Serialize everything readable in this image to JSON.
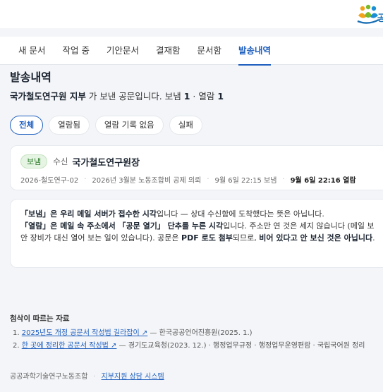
{
  "logo": {
    "text": "공"
  },
  "nav": {
    "tabs": [
      {
        "label": "새 문서"
      },
      {
        "label": "작업 중"
      },
      {
        "label": "기안문서"
      },
      {
        "label": "결재함"
      },
      {
        "label": "문서함"
      },
      {
        "label": "발송내역"
      }
    ],
    "active_index": 5
  },
  "page": {
    "title": "발송내역",
    "summary": {
      "sender": "국가철도연구원 지부",
      "text": " 가 보낸 공문입니다. 보냄 ",
      "sent_count": "1",
      "sep": " · 열람 ",
      "opened_count": "1"
    }
  },
  "filters": [
    "전체",
    "열람됨",
    "열람 기록 없음",
    "실패"
  ],
  "record": {
    "status": "보냄",
    "to_label": "수신",
    "recipient": "국가철도연구원장",
    "doc_no": "2026-철도연구-02",
    "subject": "2026년 3월분 노동조합비 공제 의뢰",
    "sent_at": "9월 6일 22:15 보냄",
    "opened_at": "9월 6일 22:16 열람"
  },
  "note": {
    "p1_a": "「보냄」은 우리 메일 서버가 접수한 시각",
    "p1_b": "입니다 — 상대 수신함에 도착했다는 뜻은 아닙니다.",
    "p2_a": "「열람」은 메일 속 주소에서 「공문 열기」 단추를 누른 시각",
    "p2_b": "입니다. 주소만 연 것은 세지 않습니다 (메일 보안 장비가 대신 열어 보는 일이 있습니다). 공문은 ",
    "p2_c": "PDF 로도 첨부",
    "p2_d": "되므로, ",
    "p2_e": "비어 있다고 안 보신 것은 아닙니다",
    "p2_f": "."
  },
  "refs": {
    "title": "첨삭이 따르는 자료",
    "items": [
      {
        "num": "1.",
        "link": "2025년도 개정 공문서 작성법 길라잡이 ↗",
        "source": " — 한국공공언어진흥원(2025. 1.)"
      },
      {
        "num": "2.",
        "link": "한 곳에 정리한 공문서 작성법 ↗",
        "source": " — 경기도교육청(2023. 12.) · 행정업무규정 · 행정업무운영편람 · 국립국어원 정리"
      }
    ]
  },
  "footer": {
    "org": "공공과학기술연구노동조합",
    "link": "지부지원 상담 시스템"
  },
  "colors": {
    "accent": "#1f5fbf",
    "badge_bg": "#e6f4e4",
    "badge_text": "#2d7a2a",
    "page_bg": "#f3f5f8"
  }
}
